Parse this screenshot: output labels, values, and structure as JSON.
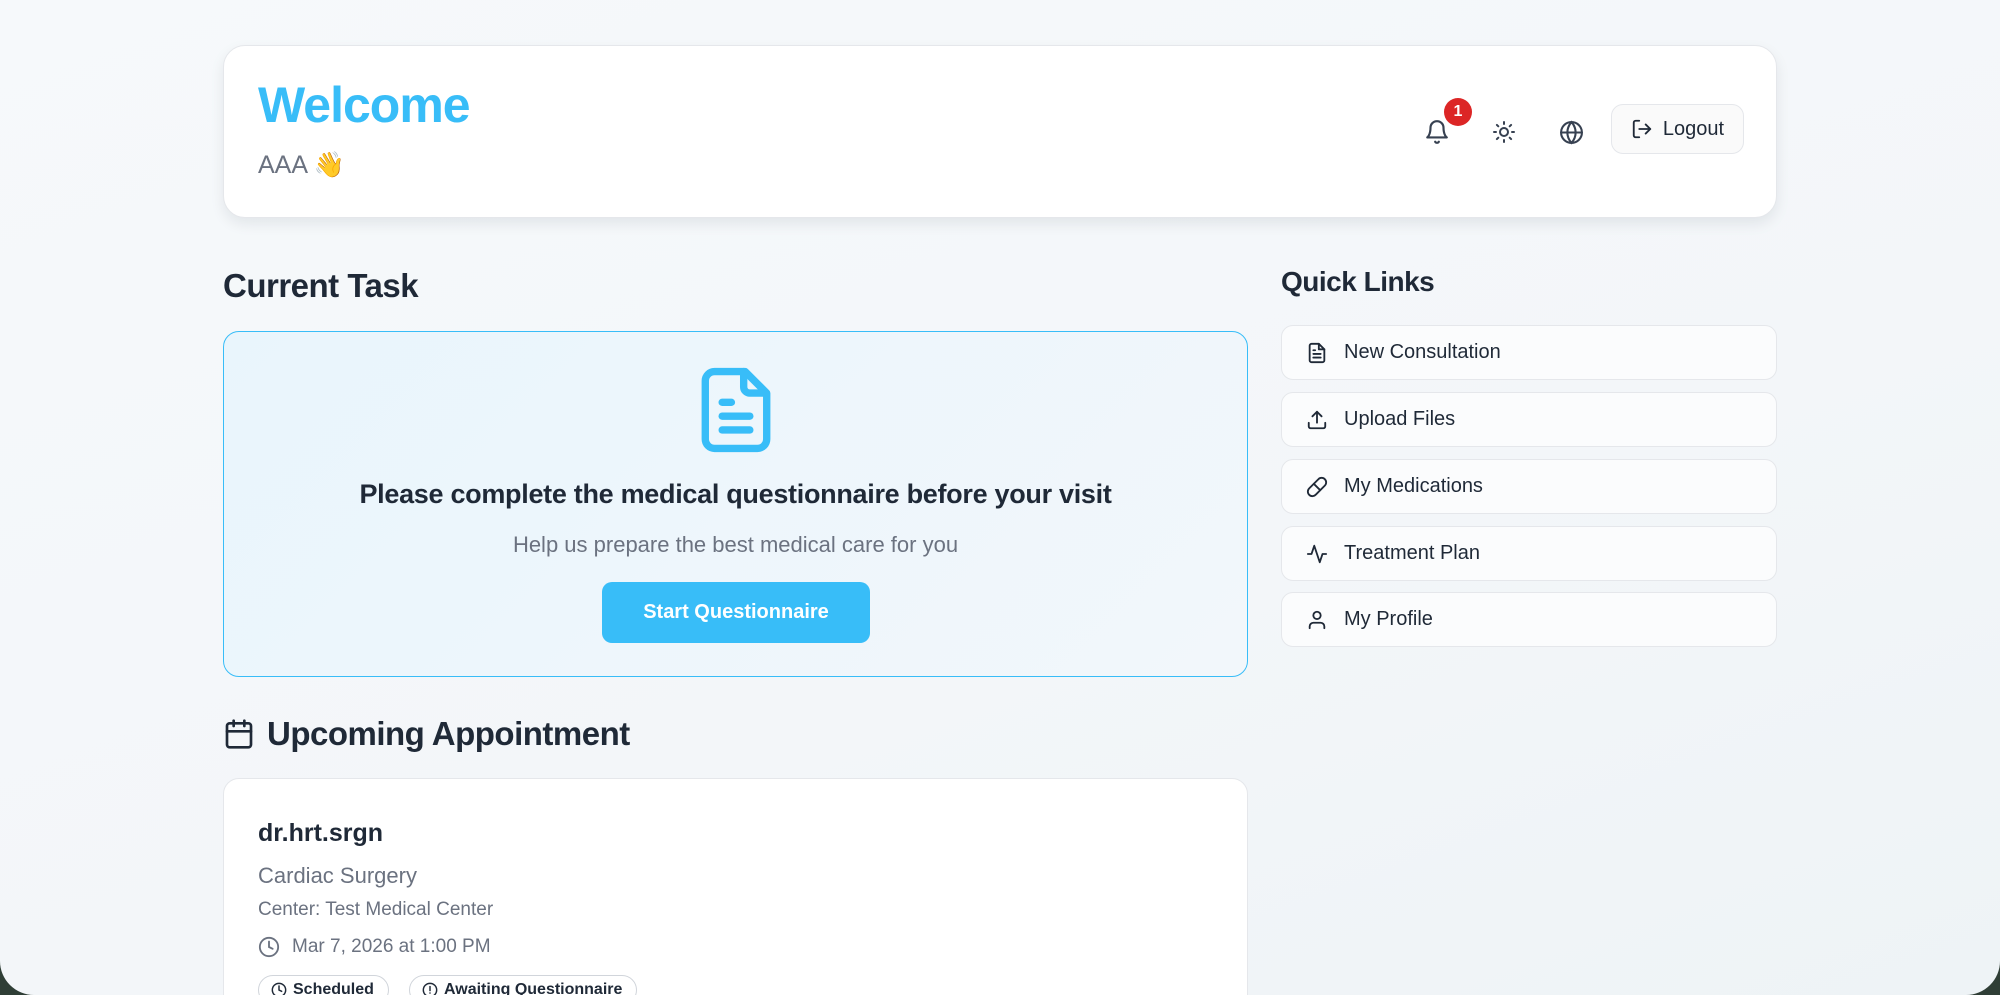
{
  "header": {
    "welcome": "Welcome",
    "user": "AAA 👋",
    "notification_count": "1",
    "logout_label": "Logout"
  },
  "current_task": {
    "heading": "Current Task",
    "title": "Please complete the medical questionnaire before your visit",
    "subtitle": "Help us prepare the best medical care for you",
    "button_label": "Start Questionnaire"
  },
  "appointment": {
    "heading": "Upcoming Appointment",
    "doctor": "dr.hrt.srgn",
    "specialty": "Cardiac Surgery",
    "center": "Center: Test Medical Center",
    "datetime": "Mar 7, 2026 at 1:00 PM",
    "status_scheduled": "Scheduled",
    "status_questionnaire": "Awaiting Questionnaire"
  },
  "quick_links": {
    "heading": "Quick Links",
    "items": [
      {
        "label": "New Consultation",
        "icon": "file-text-icon"
      },
      {
        "label": "Upload Files",
        "icon": "upload-icon"
      },
      {
        "label": "My Medications",
        "icon": "pill-icon"
      },
      {
        "label": "Treatment Plan",
        "icon": "activity-icon"
      },
      {
        "label": "My Profile",
        "icon": "user-icon"
      }
    ]
  },
  "colors": {
    "accent": "#38bdf8",
    "badge": "#dc2626"
  }
}
